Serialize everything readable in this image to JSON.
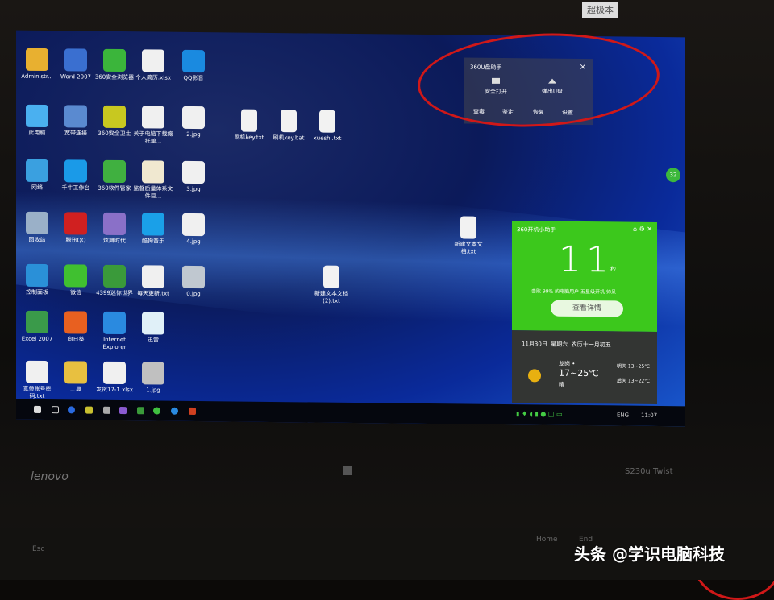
{
  "desktop": {
    "icons": [
      {
        "label": "Administr...",
        "color": "#e8b030"
      },
      {
        "label": "Word 2007",
        "color": "#3a6fd0"
      },
      {
        "label": "360安全浏览器",
        "color": "#3bb53b"
      },
      {
        "label": "个人简历.xlsx",
        "color": "#f0f0f0"
      },
      {
        "label": "QQ影音",
        "color": "#1a8ae0"
      },
      {
        "label": "此电脑",
        "color": "#4ab0f0"
      },
      {
        "label": "宽带连接",
        "color": "#5a8ad0"
      },
      {
        "label": "360安全卫士",
        "color": "#c8c820"
      },
      {
        "label": "关于电脑下载瘾托单...",
        "color": "#f0f0f0"
      },
      {
        "label": "2.jpg",
        "color": "#f0f0f0"
      },
      {
        "label": "网络",
        "color": "#3aa0e0"
      },
      {
        "label": "千牛工作台",
        "color": "#1a9ae8"
      },
      {
        "label": "360软件管家",
        "color": "#40b040"
      },
      {
        "label": "监督质量体系文件目...",
        "color": "#f0e8d0"
      },
      {
        "label": "3.jpg",
        "color": "#f0f0f0"
      },
      {
        "label": "回收站",
        "color": "#9ab0c8"
      },
      {
        "label": "腾讯QQ",
        "color": "#d02020"
      },
      {
        "label": "炫舞时代",
        "color": "#8a70c8"
      },
      {
        "label": "酷狗音乐",
        "color": "#1aa0e8"
      },
      {
        "label": "4.jpg",
        "color": "#f0f0f0"
      },
      {
        "label": "控制面板",
        "color": "#2a90d8"
      },
      {
        "label": "微信",
        "color": "#40c030"
      },
      {
        "label": "4399迷你世界",
        "color": "#3a9a3a"
      },
      {
        "label": "每天更新.txt",
        "color": "#f0f0f0"
      },
      {
        "label": "0.jpg",
        "color": "#c0c8d0"
      },
      {
        "label": "Excel 2007",
        "color": "#3a9a4a"
      },
      {
        "label": "向日葵",
        "color": "#e86020"
      },
      {
        "label": "Internet Explorer",
        "color": "#2a8ae0"
      },
      {
        "label": "迅雷",
        "color": "#e0f0f8"
      },
      {
        "label": "宽带账号密码.txt",
        "color": "#f0f0f0"
      },
      {
        "label": "工具",
        "color": "#e8c040"
      },
      {
        "label": "发货17-1.xlsx",
        "color": "#f0f0f0"
      },
      {
        "label": "1.jpg",
        "color": "#c0c0c0"
      }
    ],
    "files": [
      {
        "label": "刷机key.txt"
      },
      {
        "label": "刷机key.bat"
      },
      {
        "label": "xueshi.txt"
      },
      {
        "label": "新建文本文档.txt"
      },
      {
        "label": "新建文本文档 (2).txt"
      }
    ]
  },
  "u_helper": {
    "title": "360U盘助手",
    "close": "×",
    "open": "安全打开",
    "eject": "弹出U盘",
    "actions": [
      "查毒",
      "鉴定",
      "恢复",
      "设置"
    ]
  },
  "boot_widget": {
    "title": "360开机小助手",
    "seconds": "11",
    "unit": "秒",
    "summary": "击败 99% 的电脑用户 五星级开机 帅呆",
    "details_button": "查看详情",
    "date": "11月30日",
    "weekday": "星期六",
    "lunar": "农历十一月初五",
    "city": "龙岗 •",
    "temp": "17~25℃",
    "weather": "晴",
    "tomorrow": "明天 13~25℃",
    "after": "后天 13~22℃",
    "side_badge": "32"
  },
  "taskbar": {
    "lang": "ENG",
    "time": "11:07"
  },
  "laptop": {
    "brand": "lenovo",
    "model": "S230u Twist",
    "sticker": "超极本",
    "keys": [
      "Esc",
      "Home",
      "End"
    ]
  },
  "watermark": "头条 @学识电脑科技",
  "colors": {
    "widget_green": "#3cc81c",
    "annotation_red": "#d01818"
  }
}
